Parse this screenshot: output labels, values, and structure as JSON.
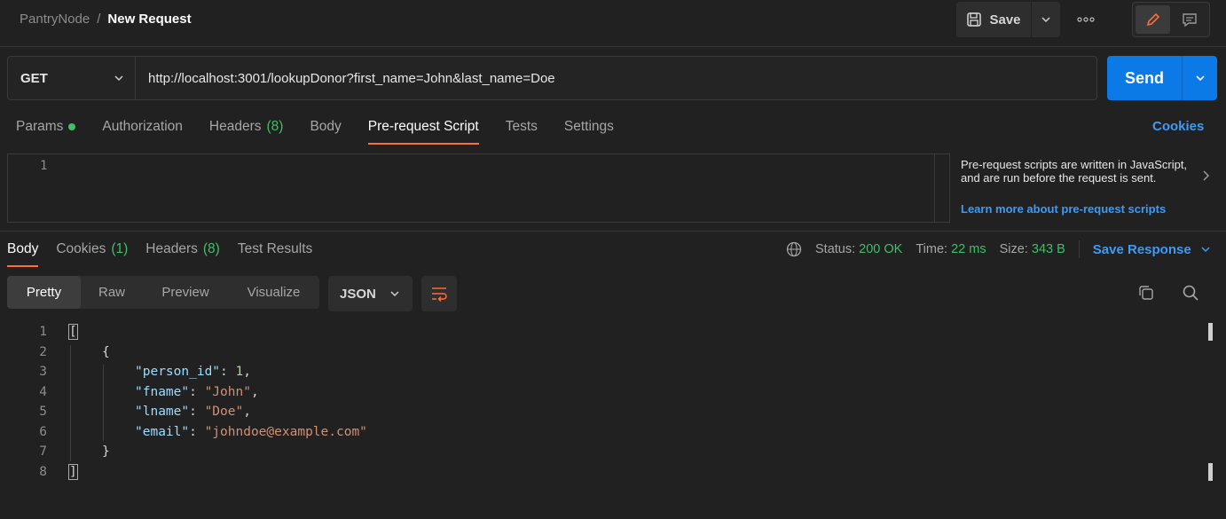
{
  "header": {
    "workspace": "PantryNode",
    "separator": "/",
    "title": "New Request",
    "save_label": "Save",
    "more_label": "•••"
  },
  "request": {
    "method": "GET",
    "url": "http://localhost:3001/lookupDonor?first_name=John&last_name=Doe",
    "send_label": "Send"
  },
  "request_tabs": [
    {
      "label": "Params",
      "count": ""
    },
    {
      "label": "Authorization",
      "count": ""
    },
    {
      "label": "Headers",
      "count": "(8)"
    },
    {
      "label": "Body",
      "count": ""
    },
    {
      "label": "Pre-request Script",
      "count": ""
    },
    {
      "label": "Tests",
      "count": ""
    },
    {
      "label": "Settings",
      "count": ""
    }
  ],
  "cookies_link": "Cookies",
  "script_editor": {
    "line_number": "1",
    "hint_text": "Pre-request scripts are written in JavaScript, and are run before the request is sent.",
    "hint_link": "Learn more about pre-request scripts"
  },
  "response_tabs": [
    {
      "label": "Body",
      "count": ""
    },
    {
      "label": "Cookies",
      "count": "(1)"
    },
    {
      "label": "Headers",
      "count": "(8)"
    },
    {
      "label": "Test Results",
      "count": ""
    }
  ],
  "status": {
    "status_label": "Status:",
    "status_value": "200 OK",
    "time_label": "Time:",
    "time_value": "22 ms",
    "size_label": "Size:",
    "size_value": "343 B",
    "save_response": "Save Response"
  },
  "format_tabs": [
    "Pretty",
    "Raw",
    "Preview",
    "Visualize"
  ],
  "language": "JSON",
  "response_lines": [
    {
      "n": "1",
      "tokens": [
        [
          "p",
          "["
        ]
      ]
    },
    {
      "n": "2",
      "tokens": [
        [
          "p",
          "{"
        ]
      ]
    },
    {
      "n": "3",
      "tokens": [
        [
          "k",
          "\"person_id\""
        ],
        [
          "p",
          ": "
        ],
        [
          "n",
          "1"
        ],
        [
          "p",
          ","
        ]
      ]
    },
    {
      "n": "4",
      "tokens": [
        [
          "k",
          "\"fname\""
        ],
        [
          "p",
          ": "
        ],
        [
          "s",
          "\"John\""
        ],
        [
          "p",
          ","
        ]
      ]
    },
    {
      "n": "5",
      "tokens": [
        [
          "k",
          "\"lname\""
        ],
        [
          "p",
          ": "
        ],
        [
          "s",
          "\"Doe\""
        ],
        [
          "p",
          ","
        ]
      ]
    },
    {
      "n": "6",
      "tokens": [
        [
          "k",
          "\"email\""
        ],
        [
          "p",
          ": "
        ],
        [
          "s",
          "\"johndoe@example.com\""
        ]
      ]
    },
    {
      "n": "7",
      "tokens": [
        [
          "p",
          "}"
        ]
      ]
    },
    {
      "n": "8",
      "tokens": [
        [
          "p",
          "]"
        ]
      ]
    }
  ],
  "colors": {
    "accent_orange": "#ff6c37",
    "send_blue": "#0b7ae6",
    "link_blue": "#3d9bf5",
    "success_green": "#3fbf67"
  }
}
